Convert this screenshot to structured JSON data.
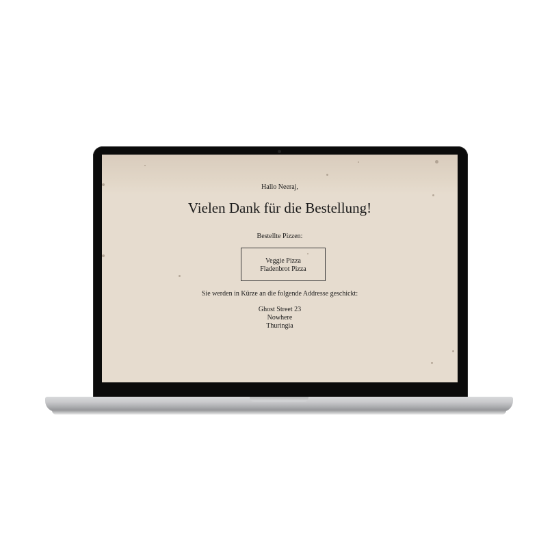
{
  "email": {
    "greeting": "Hallo Neeraj,",
    "headline": "Vielen Dank für die Bestellung!",
    "pizzas_label": "Bestellte Pizzen:",
    "pizzas": [
      "Veggie Pizza",
      "Fladenbrot Pizza"
    ],
    "address_intro": "Sie werden in Kürze an die folgende Addresse geschickt:",
    "address_lines": [
      "Ghost Street 23",
      "Nowhere",
      "Thuringia"
    ]
  },
  "colors": {
    "screen_background": "#e6dccf",
    "text": "#1a1a1a",
    "bezel": "#0b0b0b",
    "body_silver": "#c9cacc"
  },
  "icons": {
    "device": "laptop-icon"
  }
}
